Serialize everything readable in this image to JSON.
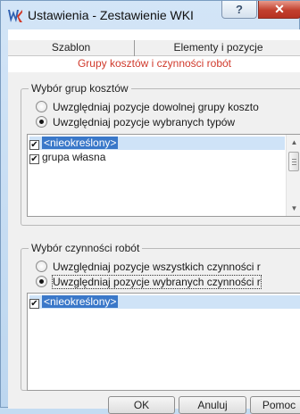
{
  "window": {
    "title": "Ustawienia - Zestawienie WKI",
    "help_label": "?",
    "close_label": "✕"
  },
  "tabs": {
    "szablon": "Szablon",
    "elementy": "Elementy i pozycje",
    "active": "Grupy kosztów i czynności robót"
  },
  "cost_groups": {
    "legend": "Wybór grup kosztów",
    "option_any": "Uwzględniaj pozycje dowolnej grupy koszto",
    "option_selected": "Uwzględniaj pozycje wybranych typów",
    "selected_option": "option_selected",
    "items": [
      {
        "label": "<nieokreślony>",
        "checked": true,
        "selected": true
      },
      {
        "label": "grupa własna",
        "checked": true,
        "selected": false
      }
    ]
  },
  "activities": {
    "legend": "Wybór czynności robót",
    "option_all": "Uwzględniaj pozycje wszystkich czynności r",
    "option_selected": "Uwzględniaj pozycje wybranych czynności r",
    "selected_option": "option_selected",
    "items": [
      {
        "label": "<nieokreślony>",
        "checked": true,
        "selected": true
      }
    ]
  },
  "buttons": {
    "ok": "OK",
    "cancel": "Anuluj",
    "help": "Pomoc"
  },
  "icons": {
    "app": "wki-app-icon",
    "scroll_up": "scroll-up-icon",
    "scroll_down": "scroll-down-icon"
  },
  "colors": {
    "active_tab_text": "#d0392b",
    "selection": "#3a78c9",
    "close_button": "#c2402e"
  }
}
